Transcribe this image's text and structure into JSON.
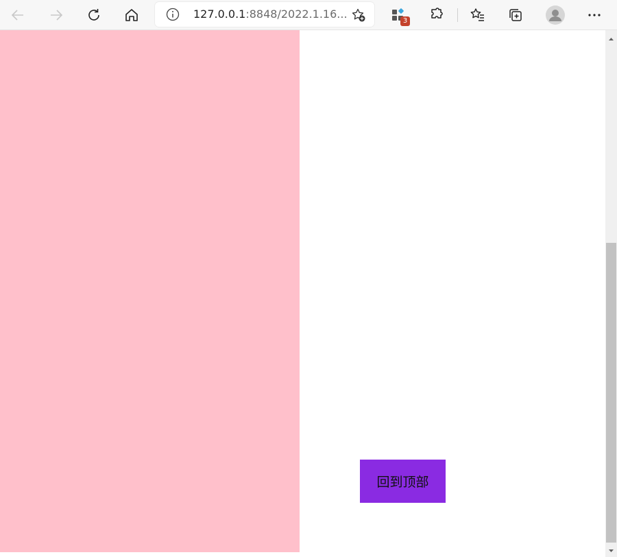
{
  "browser": {
    "address_bar": {
      "url_host": "127.0.0.1",
      "url_rest": ":8848/2022.1.16..."
    },
    "extensions_badge": "3",
    "colors": {
      "toolbar_bg": "#f7f7f7",
      "badge": "#c4412b"
    }
  },
  "page": {
    "back_to_top_label": "回到顶部",
    "colors": {
      "panel": "pink",
      "button": "#8a2be2",
      "scroll_thumb": "#c2c2c2"
    }
  }
}
